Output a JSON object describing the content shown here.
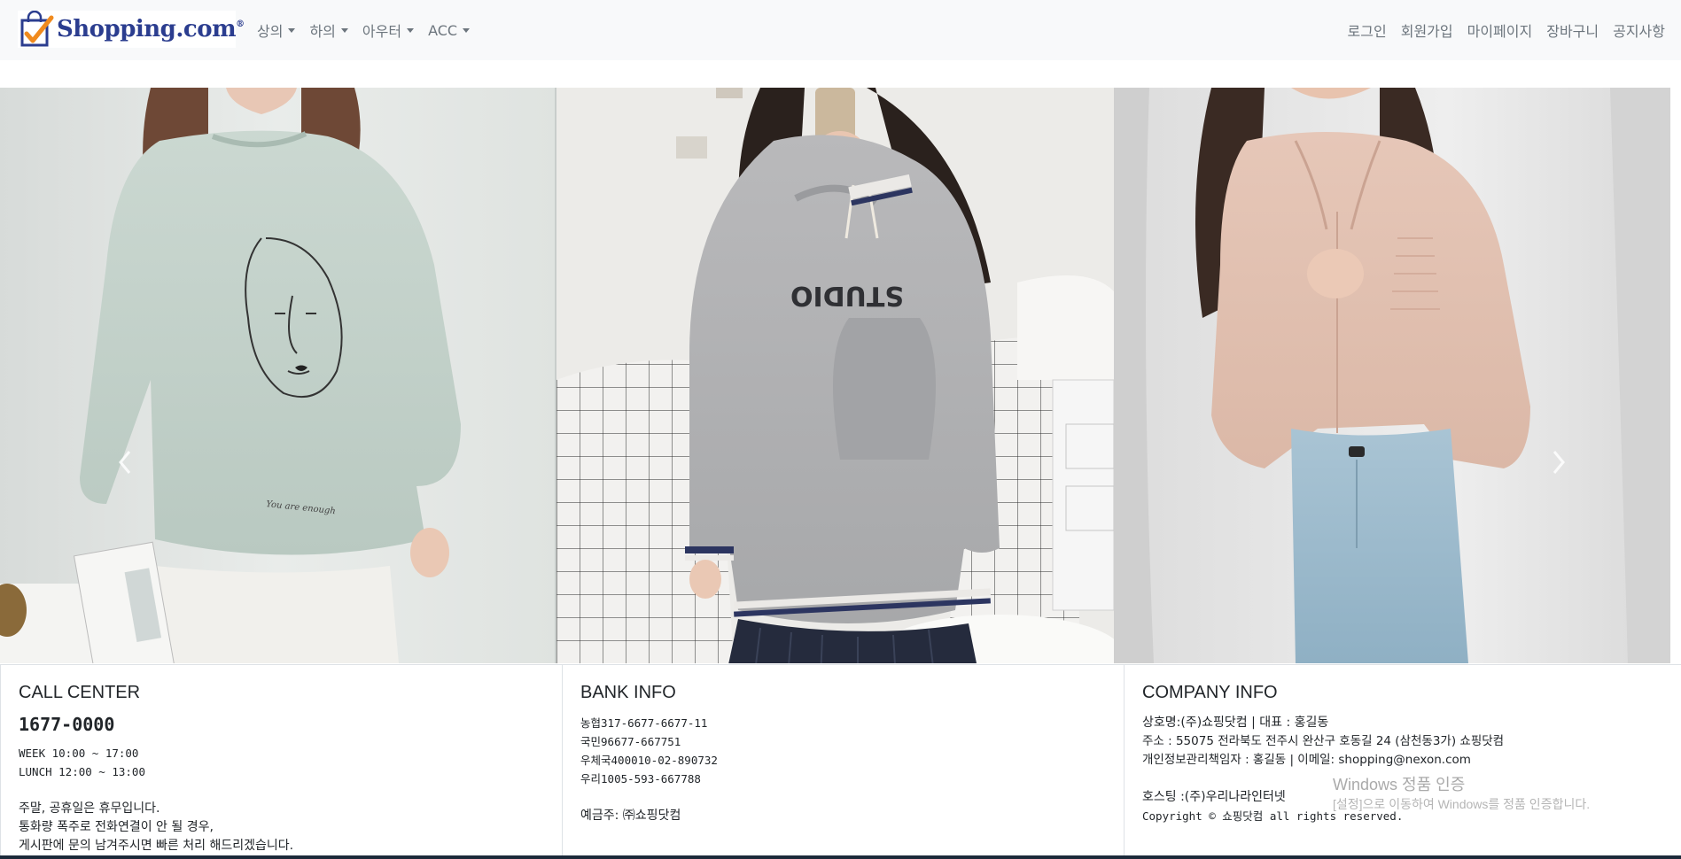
{
  "brand": {
    "logo_text": "Shopping.com",
    "registered": "®"
  },
  "nav": {
    "left_menu": [
      {
        "label": "상의"
      },
      {
        "label": "하의"
      },
      {
        "label": "아우터"
      },
      {
        "label": "ACC"
      }
    ],
    "right_links": [
      {
        "label": "로그인"
      },
      {
        "label": "회원가입"
      },
      {
        "label": "마이페이지"
      },
      {
        "label": "장바구니"
      },
      {
        "label": "공지사항"
      }
    ]
  },
  "carousel": {
    "slides": [
      {
        "icon": "photo-mint-sweatshirt-model",
        "print": "You are enough"
      },
      {
        "icon": "photo-grey-hoodie-model",
        "print": "STUDIO"
      },
      {
        "icon": "photo-pink-blouse-model"
      }
    ],
    "prev_icon": "chevron-left-icon",
    "next_icon": "chevron-right-icon"
  },
  "footer": {
    "call_center": {
      "title": "CALL CENTER",
      "phone": "1677-0000",
      "hours": [
        "WEEK 10:00 ~ 17:00",
        "LUNCH 12:00 ~ 13:00"
      ],
      "notes": [
        "주말, 공휴일은 휴무입니다.",
        "통화량 폭주로 전화연결이 안 될 경우,",
        "게시판에 문의 남겨주시면 빠른 처리 해드리겠습니다."
      ]
    },
    "bank_info": {
      "title": "BANK INFO",
      "accounts": [
        {
          "bank": "농협",
          "number": "317-6677-6677-11"
        },
        {
          "bank": "국민",
          "number": "96677-667751"
        },
        {
          "bank": "우체국",
          "number": "400010-02-890732"
        },
        {
          "bank": "우리",
          "number": "1005-593-667788"
        }
      ],
      "depositor": "예금주: ㈜쇼핑닷컴"
    },
    "company_info": {
      "title": "COMPANY INFO",
      "lines": [
        "상호명:(주)쇼핑닷컴 | 대표 : 홍길동",
        "주소 : 55075 전라북도 전주시 완산구 호동길 24 (삼천동3가) 쇼핑닷컴",
        "개인정보관리책임자 : 홍길동 | 이메일: shopping@nexon.com"
      ],
      "hosting": "호스팅 :(주)우리나라인터넷",
      "copyright": "Copyright © 쇼핑닷컴 all rights reserved."
    }
  },
  "watermark": {
    "title": "Windows 정품 인증",
    "subtitle": "[설정]으로 이동하여 Windows를 정품 인증합니다."
  },
  "colors": {
    "navbar_bg": "#f8f9fa",
    "nav_text": "#6c757d",
    "logo_text": "#2b3d8f",
    "logo_orange": "#f08a1d"
  }
}
